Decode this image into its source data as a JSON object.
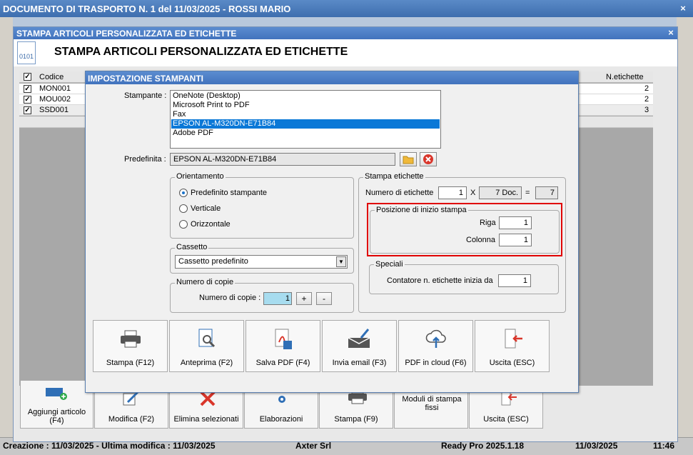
{
  "window": {
    "title": "DOCUMENTO DI TRASPORTO N. 1 del 11/03/2025 - ROSSI MARIO",
    "close": "×"
  },
  "status": {
    "created": "Creazione : 11/03/2025 - Ultima modifica : 11/03/2025",
    "company": "Axter Srl",
    "version": "Ready Pro 2025.1.18",
    "date": "11/03/2025",
    "time": "11:46"
  },
  "dialog": {
    "title": "STAMPA ARTICOLI PERSONALIZZATA ED ETICHETTE",
    "heading": "STAMPA ARTICOLI PERSONALIZZATA ED ETICHETTE",
    "icon_text": "0101",
    "close": "×",
    "grid": {
      "columns": [
        "Codice",
        "N.etichette"
      ],
      "rows": [
        {
          "code": "MON001",
          "labels": "2",
          "checked": true
        },
        {
          "code": "MOU002",
          "labels": "2",
          "checked": true
        },
        {
          "code": "SSD001",
          "labels": "3",
          "checked": true
        }
      ]
    },
    "toolbar": [
      {
        "label": "Aggiungi articolo (F4)",
        "icon": "add-article-icon"
      },
      {
        "label": "Modifica (F2)",
        "icon": "edit-icon"
      },
      {
        "label": "Elimina selezionati",
        "icon": "delete-icon"
      },
      {
        "label": "Elaborazioni",
        "icon": "gears-icon"
      },
      {
        "label": "Stampa (F9)",
        "icon": "printer-icon"
      },
      {
        "label": "Moduli di stampa fissi",
        "icon": ""
      },
      {
        "label": "Uscita (ESC)",
        "icon": "exit-icon"
      }
    ]
  },
  "modal": {
    "title": "IMPOSTAZIONE STAMPANTI",
    "printer_label": "Stampante :",
    "printers": [
      "OneNote (Desktop)",
      "Microsoft Print to PDF",
      "Fax",
      "EPSON AL-M320DN-E71B84",
      "Adobe PDF"
    ],
    "selected_printer_index": 3,
    "default_label": "Predefinita :",
    "default_value": "EPSON AL-M320DN-E71B84",
    "orientation": {
      "title": "Orientamento",
      "options": [
        "Predefinito stampante",
        "Verticale",
        "Orizzontale"
      ],
      "selected": 0
    },
    "tray": {
      "title": "Cassetto",
      "value": "Cassetto predefinito"
    },
    "copies": {
      "title": "Numero di copie",
      "label": "Numero di copie :",
      "value": "1",
      "plus": "+",
      "minus": "-"
    },
    "labels": {
      "title": "Stampa etichette",
      "count_label": "Numero di etichette",
      "count": "1",
      "times": "X",
      "docs": "7 Doc.",
      "equals": "=",
      "total": "7",
      "start": {
        "title": "Posizione di inizio stampa",
        "row_label": "Riga",
        "row": "1",
        "col_label": "Colonna",
        "col": "1"
      },
      "special": {
        "title": "Speciali",
        "counter_label": "Contatore n. etichette inizia da",
        "counter": "1"
      }
    },
    "buttons": [
      {
        "label": "Stampa (F12)",
        "icon": "printer-icon"
      },
      {
        "label": "Anteprima (F2)",
        "icon": "preview-icon"
      },
      {
        "label": "Salva PDF (F4)",
        "icon": "pdf-icon"
      },
      {
        "label": "Invia email (F3)",
        "icon": "email-icon"
      },
      {
        "label": "PDF in cloud (F6)",
        "icon": "cloud-upload-icon"
      },
      {
        "label": "Uscita (ESC)",
        "icon": "exit-icon"
      }
    ],
    "highlight_color": "#e00000"
  }
}
